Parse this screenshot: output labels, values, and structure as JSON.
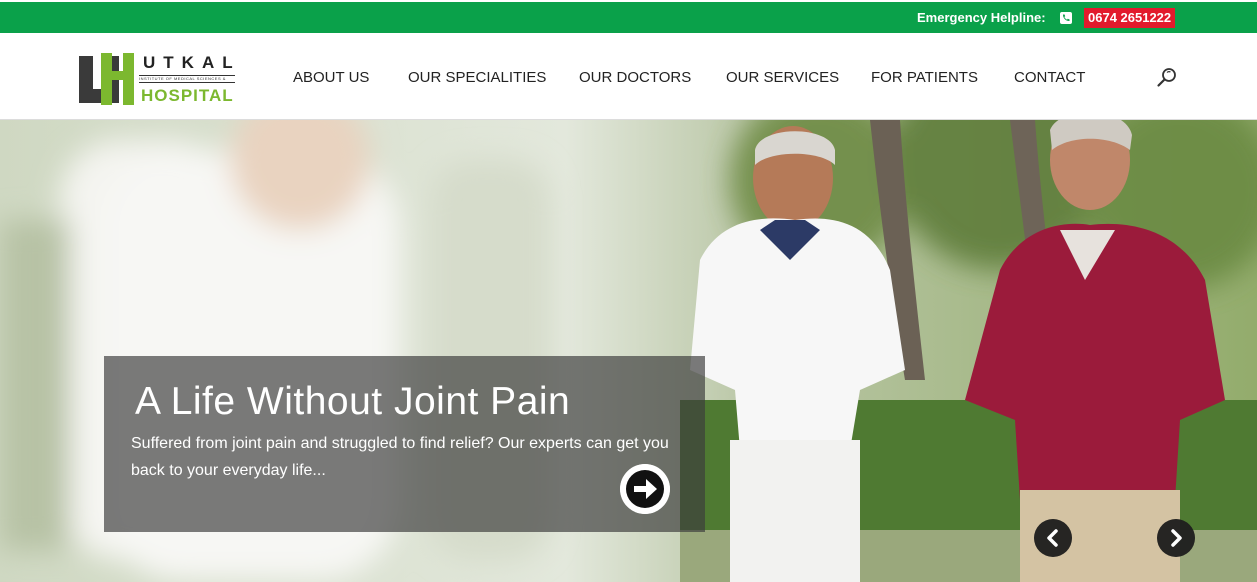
{
  "topbar": {
    "helpline_label": "Emergency Helpline:",
    "helpline_number": "0674 2651222",
    "phone_icon": "phone-icon",
    "colors": {
      "background": "#0aa14a",
      "number_badge": "#e21a2c"
    }
  },
  "logo": {
    "utkal": "UTKAL",
    "institute": "INSTITUTE OF MEDICAL SCIENCES &",
    "hospital": "HOSPITAL",
    "colors": {
      "mark_dark": "#3a3a3a",
      "mark_green": "#7cb82f"
    }
  },
  "nav": {
    "items": [
      {
        "label": "ABOUT US"
      },
      {
        "label": "OUR SPECIALITIES"
      },
      {
        "label": "OUR DOCTORS"
      },
      {
        "label": "OUR SERVICES"
      },
      {
        "label": "FOR PATIENTS"
      },
      {
        "label": "CONTACT"
      }
    ],
    "search_icon": "search-icon"
  },
  "hero": {
    "title": "A Life Without Joint Pain",
    "text": "Suffered from joint pain and struggled to find relief? Our experts can get you back to your everyday life...",
    "read_more_icon": "arrow-right-circle-icon",
    "prev_icon": "chevron-left-icon",
    "next_icon": "chevron-right-icon"
  }
}
